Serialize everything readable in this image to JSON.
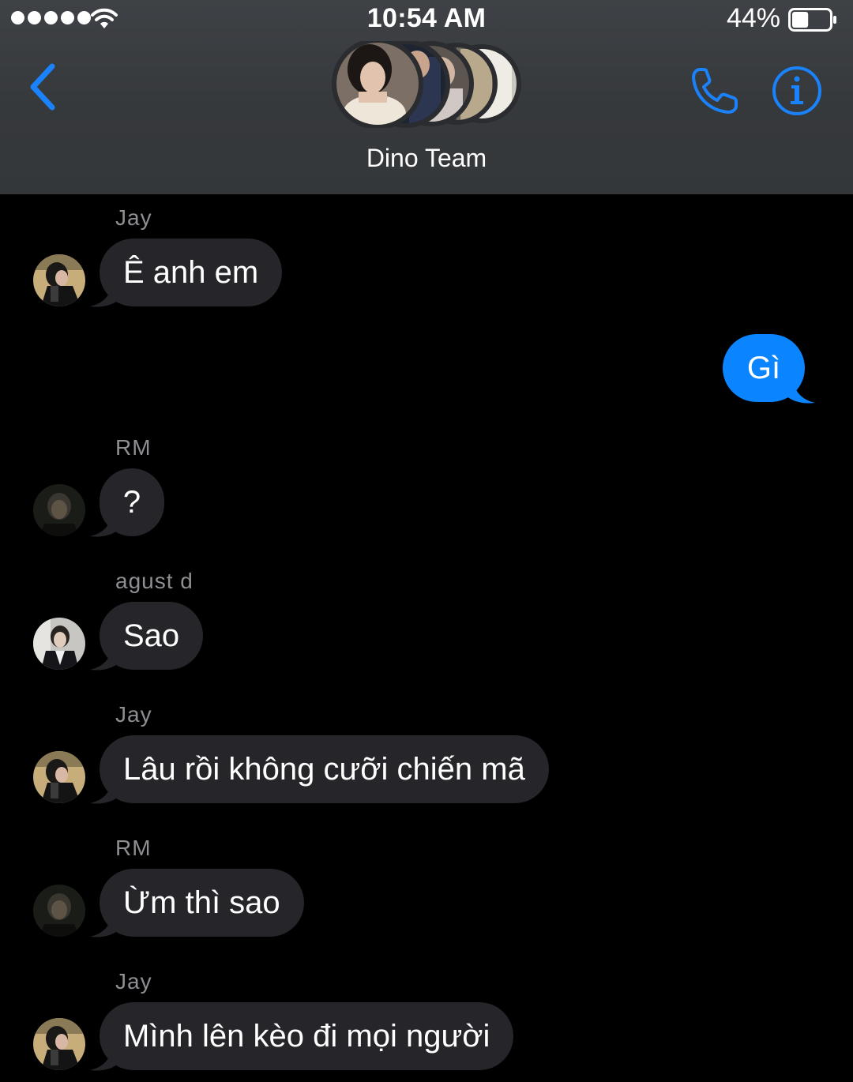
{
  "status_bar": {
    "time": "10:54 AM",
    "battery": "44%",
    "battery_fraction": 0.44,
    "signal_bars": 5,
    "wifi_icon": "wifi-icon"
  },
  "header": {
    "group_name": "Dino Team",
    "back_icon": "chevron-left-icon",
    "call_icon": "phone-icon",
    "info_icon": "info-icon",
    "accent_color": "#1a82fb"
  },
  "colors": {
    "incoming_bubble": "#26252a",
    "outgoing_bubble": "#0a84ff",
    "background": "#000000",
    "sender_name": "#8e8e93"
  },
  "messages": [
    {
      "sender": "Jay",
      "text": "Ê anh em",
      "direction": "incoming"
    },
    {
      "sender": "",
      "text": "Gì",
      "direction": "outgoing"
    },
    {
      "sender": "RM",
      "text": "?",
      "direction": "incoming"
    },
    {
      "sender": "agust d",
      "text": "Sao",
      "direction": "incoming"
    },
    {
      "sender": "Jay",
      "text": "Lâu rồi không cưỡi chiến mã",
      "direction": "incoming"
    },
    {
      "sender": "RM",
      "text": "Ừm thì sao",
      "direction": "incoming"
    },
    {
      "sender": "Jay",
      "text": "Mình lên kèo đi mọi người",
      "direction": "incoming"
    }
  ]
}
